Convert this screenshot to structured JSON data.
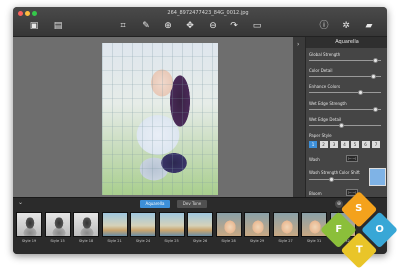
{
  "window": {
    "title": "264_8972477423_84G_0012.jpg",
    "traffic_colors": [
      "#fc615d",
      "#fdbc40",
      "#34c84a"
    ]
  },
  "toolbar": {
    "items": [
      {
        "name": "open-image-icon",
        "glyph": "▣"
      },
      {
        "name": "export-icon",
        "glyph": "▤"
      },
      {
        "name": "crop-icon",
        "glyph": "⌗"
      },
      {
        "name": "brush-icon",
        "glyph": "✎"
      },
      {
        "name": "zoom-in-icon",
        "glyph": "⊕"
      },
      {
        "name": "move-icon",
        "glyph": "✥"
      },
      {
        "name": "zoom-out-icon",
        "glyph": "⊖"
      },
      {
        "name": "redo-icon",
        "glyph": "↷"
      },
      {
        "name": "compare-icon",
        "glyph": "▭"
      },
      {
        "name": "info-icon",
        "glyph": "ⓘ"
      },
      {
        "name": "settings-icon",
        "glyph": "✲"
      },
      {
        "name": "share-icon",
        "glyph": "▰"
      }
    ]
  },
  "panel": {
    "collapse_glyph": "›",
    "header": "Aquarella",
    "controls": [
      {
        "label": "Global Strength",
        "value": 0.92
      },
      {
        "label": "Color Detail",
        "value": 0.9
      },
      {
        "label": "Enhance Colors",
        "value": 0.72
      },
      {
        "label": "Wet Edge Strength",
        "value": 0.92
      },
      {
        "label": "Wet Edge Detail",
        "value": 0.45
      }
    ],
    "paper_style_label": "Paper Style",
    "paper_buttons": [
      "1",
      "2",
      "3",
      "4",
      "5",
      "6",
      "7"
    ],
    "active_paper": 0,
    "wash_label": "Wash",
    "wash_value_glyph": "⊢⊣",
    "wash_strength_label": "Wash Strength",
    "color_shift_label": "Color Shift",
    "bloom_label": "Bloom",
    "bloom_value_glyph": "⊢⊣",
    "color_shift_color": "#7fb3e6"
  },
  "filmstrip": {
    "chevron": "⌄",
    "tabs": [
      {
        "label": "Aquarella",
        "active": true
      },
      {
        "label": "Dev Tone",
        "active": false
      }
    ],
    "buttons": [
      "⊕",
      "⊖",
      "−"
    ],
    "thumbnails": [
      {
        "label": "Style 19",
        "style": "bw"
      },
      {
        "label": "Style 15",
        "style": "bw"
      },
      {
        "label": "Style 18",
        "style": "bw"
      },
      {
        "label": "Style 21",
        "style": "beach"
      },
      {
        "label": "Style 24",
        "style": "beach"
      },
      {
        "label": "Style 25",
        "style": "beach"
      },
      {
        "label": "Style 26",
        "style": "beach"
      },
      {
        "label": "Style 28",
        "style": "cat"
      },
      {
        "label": "Style 29",
        "style": "cat"
      },
      {
        "label": "Style 27",
        "style": "cat"
      },
      {
        "label": "Style 31",
        "style": "cat"
      },
      {
        "label": "Style 32",
        "style": "cat"
      }
    ]
  },
  "watermark": {
    "tiles": [
      {
        "letter": "S",
        "color": "#f4a21c"
      },
      {
        "letter": "O",
        "color": "#38a7d6"
      },
      {
        "letter": "F",
        "color": "#8bbf3a"
      },
      {
        "letter": "T",
        "color": "#e9c529"
      }
    ]
  }
}
